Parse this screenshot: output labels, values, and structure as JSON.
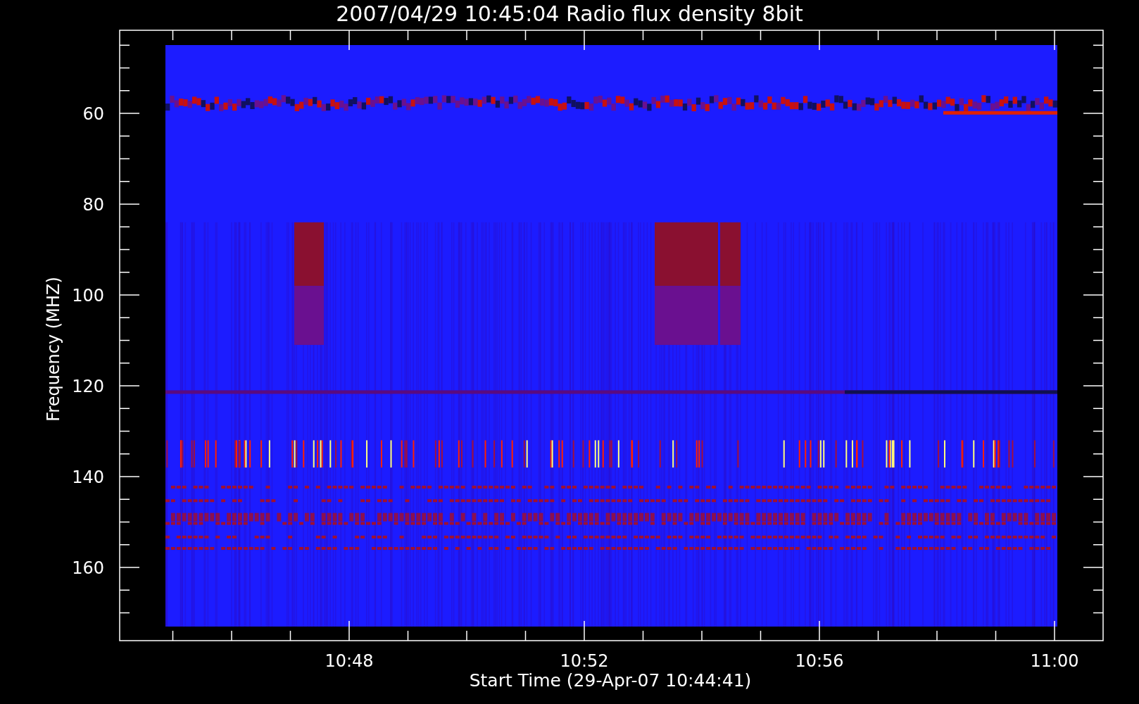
{
  "title": "2007/04/29 10:45:04 Radio flux density 8bit",
  "y_axis": {
    "label": "Frequency (MHZ)",
    "ticks": [
      "60",
      "80",
      "100",
      "120",
      "140",
      "160"
    ]
  },
  "x_axis": {
    "label": "Start Time (29-Apr-07 10:44:41)",
    "ticks": [
      "10:48",
      "10:52",
      "10:56",
      "11:00"
    ]
  }
}
